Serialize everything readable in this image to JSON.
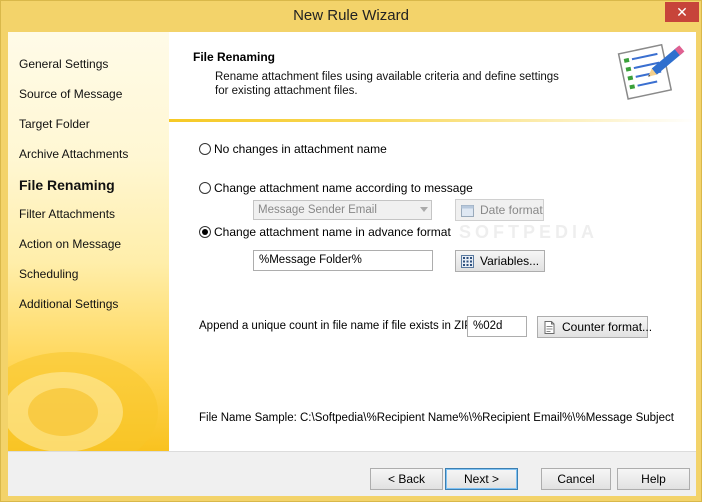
{
  "window": {
    "title": "New Rule Wizard",
    "close_glyph": "✕"
  },
  "sidebar": {
    "items": [
      {
        "label": "General Settings",
        "active": false
      },
      {
        "label": "Source of Message",
        "active": false
      },
      {
        "label": "Target Folder",
        "active": false
      },
      {
        "label": "Archive Attachments",
        "active": false
      },
      {
        "label": "File Renaming",
        "active": true
      },
      {
        "label": "Filter Attachments",
        "active": false
      },
      {
        "label": "Action on Message",
        "active": false
      },
      {
        "label": "Scheduling",
        "active": false
      },
      {
        "label": "Additional Settings",
        "active": false
      }
    ]
  },
  "header": {
    "title": "File Renaming",
    "description": "Rename attachment files using available criteria and define settings for existing attachment files.",
    "icon": "notepad-pen-icon"
  },
  "options": {
    "no_change": {
      "label": "No changes in attachment name",
      "checked": false
    },
    "by_message": {
      "label": "Change attachment name according to message",
      "checked": false
    },
    "by_message_combo": "Message Sender Email",
    "date_format_label": "Date format",
    "advanced": {
      "label": "Change attachment name in advance format",
      "checked": true
    },
    "advanced_value": "%Message Folder%",
    "variables_label": "Variables...",
    "zip_label": "Append a unique count in file name if file exists in ZIP:",
    "zip_value": "%02d",
    "counter_label": "Counter format...",
    "sample_label": "File Name Sample:",
    "sample_value": "C:\\Softpedia\\%Recipient Name%\\%Recipient Email%\\%Message Subject%\\%"
  },
  "footer": {
    "back": "< Back",
    "next": "Next >",
    "cancel": "Cancel",
    "help": "Help"
  },
  "watermark": "SOFTPEDIA"
}
